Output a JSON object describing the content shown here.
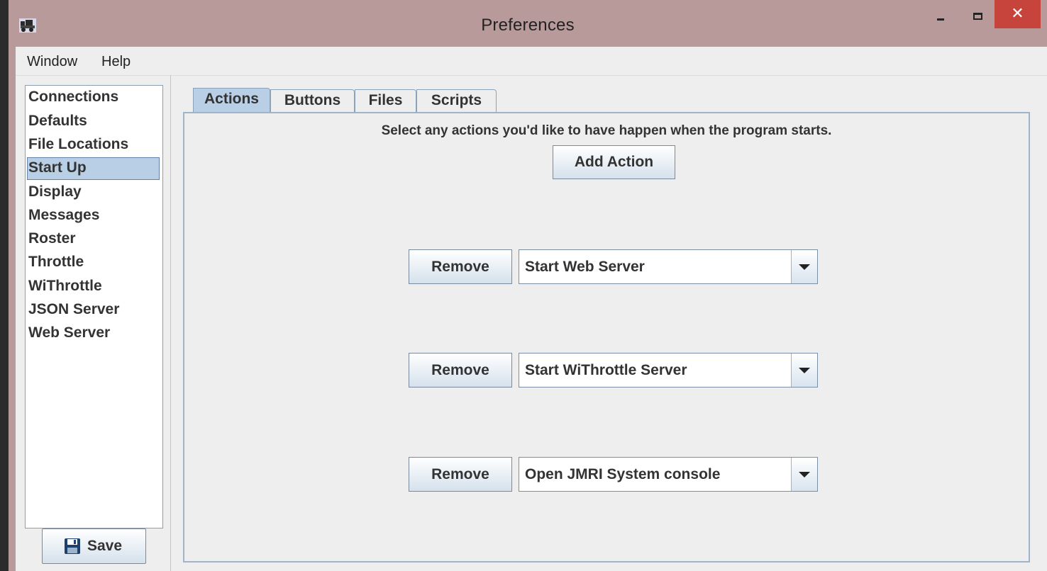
{
  "window": {
    "title": "Preferences",
    "close_glyph": "✕",
    "accent_color": "#b89a9a",
    "close_color": "#c7443c"
  },
  "menubar": {
    "items": [
      "Window",
      "Help"
    ]
  },
  "sidebar": {
    "items": [
      {
        "label": "Connections"
      },
      {
        "label": "Defaults"
      },
      {
        "label": "File Locations"
      },
      {
        "label": "Start Up",
        "selected": true
      },
      {
        "label": "Display"
      },
      {
        "label": "Messages"
      },
      {
        "label": "Roster"
      },
      {
        "label": "Throttle"
      },
      {
        "label": "WiThrottle"
      },
      {
        "label": "JSON Server"
      },
      {
        "label": "Web Server"
      }
    ],
    "selected_color": "#b8cfe5",
    "save_label": "Save",
    "save_icon": "floppy-disk-icon"
  },
  "tabs": {
    "items": [
      {
        "label": "Actions",
        "active": true
      },
      {
        "label": "Buttons"
      },
      {
        "label": "Files"
      },
      {
        "label": "Scripts"
      }
    ]
  },
  "actions": {
    "instructions": "Select any actions you'd like to have happen when the program starts.",
    "add_label": "Add Action",
    "remove_label": "Remove",
    "rows": [
      {
        "value": "Start Web Server"
      },
      {
        "value": "Start WiThrottle Server"
      },
      {
        "value": "Open JMRI System console"
      }
    ]
  }
}
